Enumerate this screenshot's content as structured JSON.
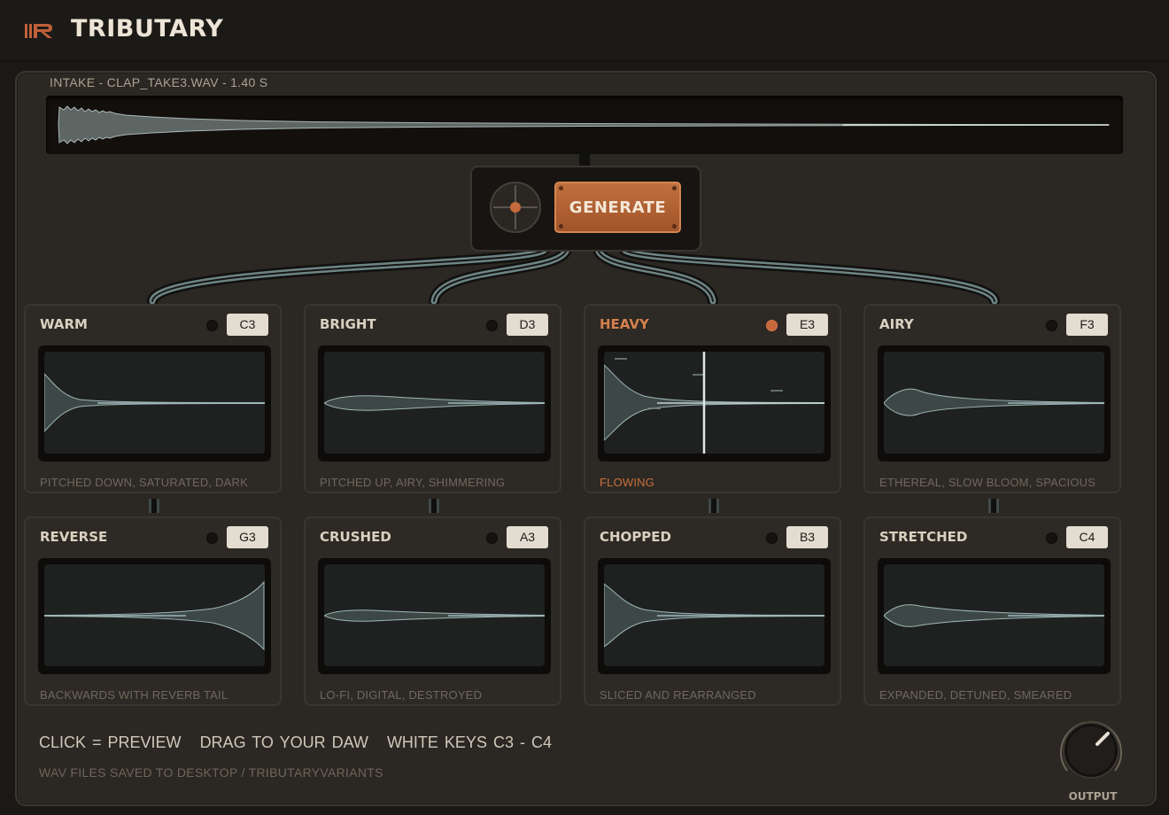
{
  "app": {
    "title": "TRIBUTARY"
  },
  "intake": {
    "label": "INTAKE  -  CLAP_TAKE3.WAV  -  1.40 S"
  },
  "generate": {
    "label": "GENERATE"
  },
  "variants": [
    {
      "name": "WARM",
      "note": "C3",
      "desc": "PITCHED DOWN, SATURATED, DARK",
      "active": false
    },
    {
      "name": "BRIGHT",
      "note": "D3",
      "desc": "PITCHED UP, AIRY, SHIMMERING",
      "active": false
    },
    {
      "name": "HEAVY",
      "note": "E3",
      "desc": "FLOWING",
      "active": true
    },
    {
      "name": "AIRY",
      "note": "F3",
      "desc": "ETHEREAL, SLOW BLOOM, SPACIOUS",
      "active": false
    },
    {
      "name": "REVERSE",
      "note": "G3",
      "desc": "BACKWARDS WITH REVERB TAIL",
      "active": false
    },
    {
      "name": "CRUSHED",
      "note": "A3",
      "desc": "LO-FI, DIGITAL, DESTROYED",
      "active": false
    },
    {
      "name": "CHOPPED",
      "note": "B3",
      "desc": "SLICED AND REARRANGED",
      "active": false
    },
    {
      "name": "STRETCHED",
      "note": "C4",
      "desc": "EXPANDED, DETUNED, SMEARED",
      "active": false
    }
  ],
  "help": {
    "click": "CLICK = PREVIEW",
    "drag": "DRAG TO YOUR DAW",
    "keys": "WHITE KEYS C3 - C4",
    "save": "WAV FILES SAVED TO  DESKTOP / TRIBUTARYVARIANTS"
  },
  "output": {
    "label": "OUTPUT"
  },
  "colors": {
    "accent": "#c0703f",
    "wave": "#9fb6b8",
    "wave_fill": "#3f4a49"
  }
}
